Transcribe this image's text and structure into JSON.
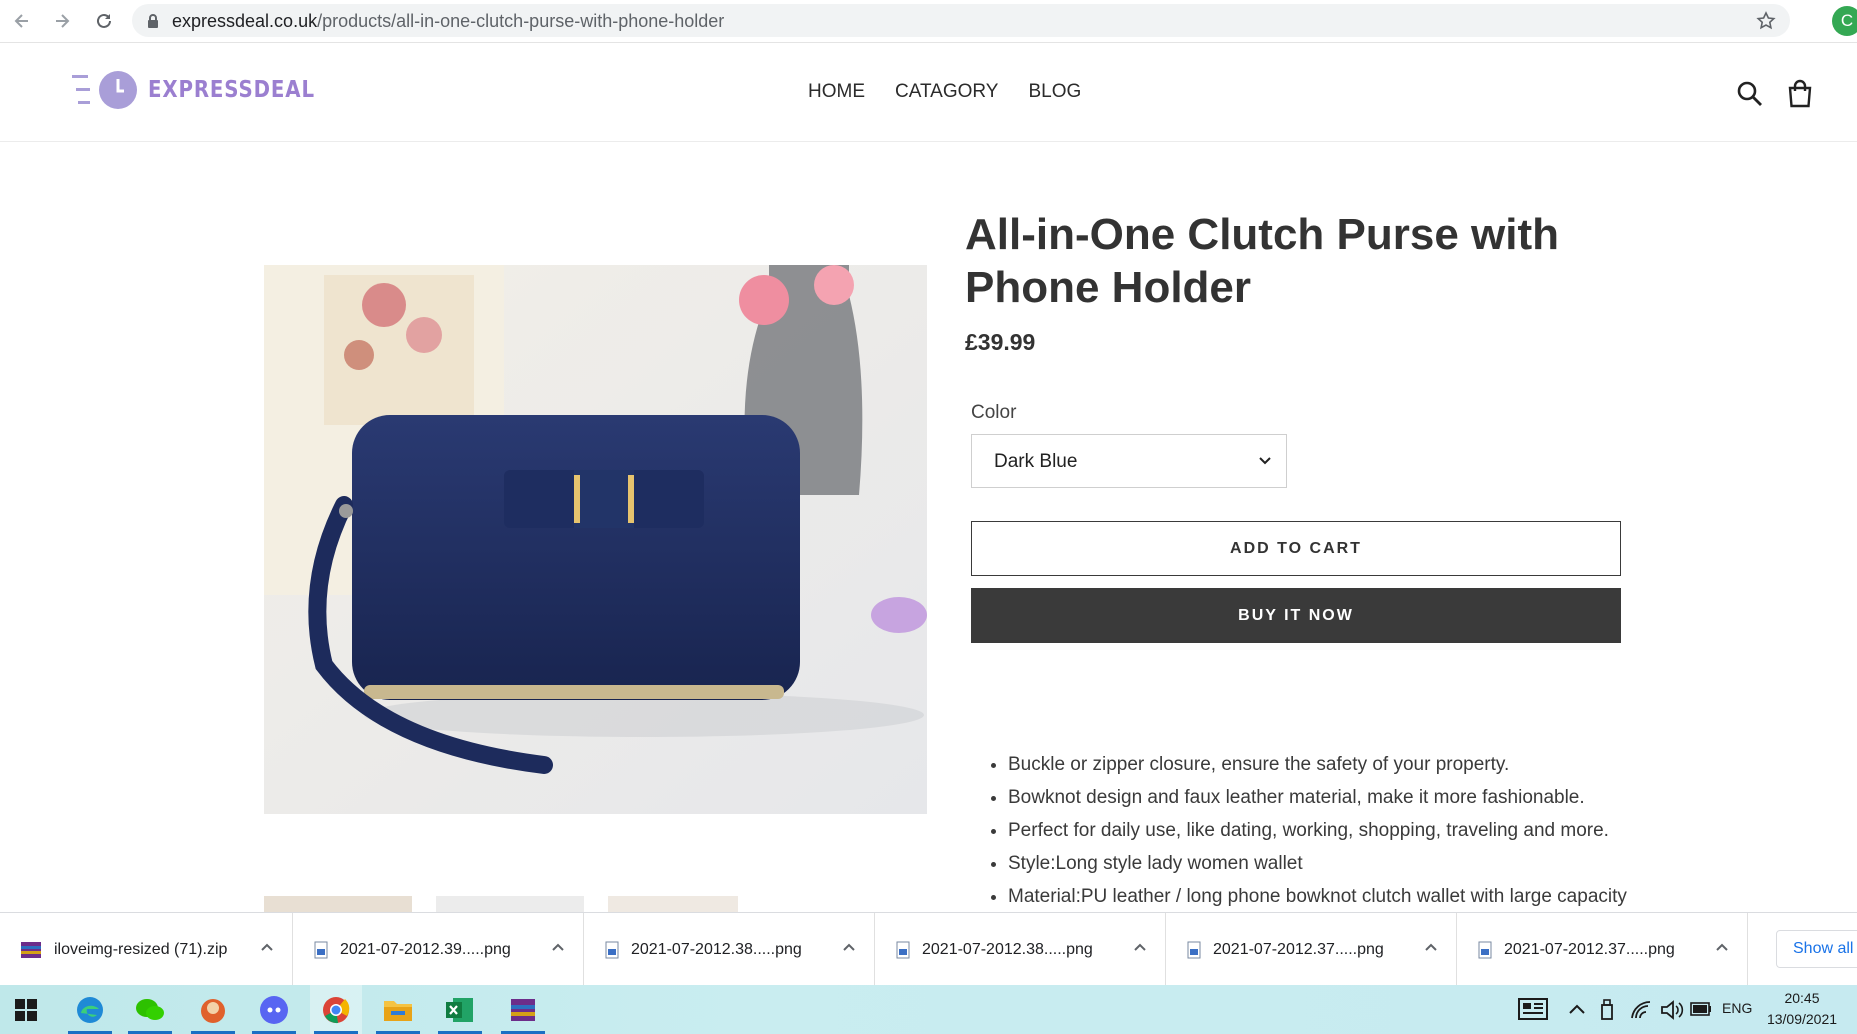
{
  "browser": {
    "url_domain": "expressdeal.co.uk",
    "url_path": "/products/all-in-one-clutch-purse-with-phone-holder",
    "profile_initial": "C"
  },
  "site": {
    "logo_text": "EXPRESSDEAL",
    "nav": [
      "HOME",
      "CATAGORY",
      "BLOG"
    ]
  },
  "product": {
    "title": "All-in-One Clutch Purse with Phone Holder",
    "price": "£39.99",
    "color_label": "Color",
    "color_value": "Dark Blue",
    "add_to_cart": "ADD TO CART",
    "buy_now": "BUY IT NOW",
    "features": [
      "Buckle or zipper closure, ensure the safety of your property.",
      "Bowknot design and faux leather material, make it more fashionable.",
      "Perfect for daily use, like dating, working, shopping, traveling and more.",
      "Style:Long style lady women wallet",
      "Material:PU leather / long phone bowknot clutch wallet with large capacity"
    ]
  },
  "downloads": {
    "items": [
      "iloveimg-resized (71).zip",
      "2021-07-2012.39.....png",
      "2021-07-2012.38.....png",
      "2021-07-2012.38.....png",
      "2021-07-2012.37.....png",
      "2021-07-2012.37.....png"
    ],
    "show_all": "Show all"
  },
  "taskbar": {
    "language": "ENG",
    "time": "20:45",
    "date": "13/09/2021"
  },
  "colors": {
    "brand": "#9b7fd0",
    "buy_button": "#3a3a3a",
    "product_blue": "#1f2f63"
  }
}
